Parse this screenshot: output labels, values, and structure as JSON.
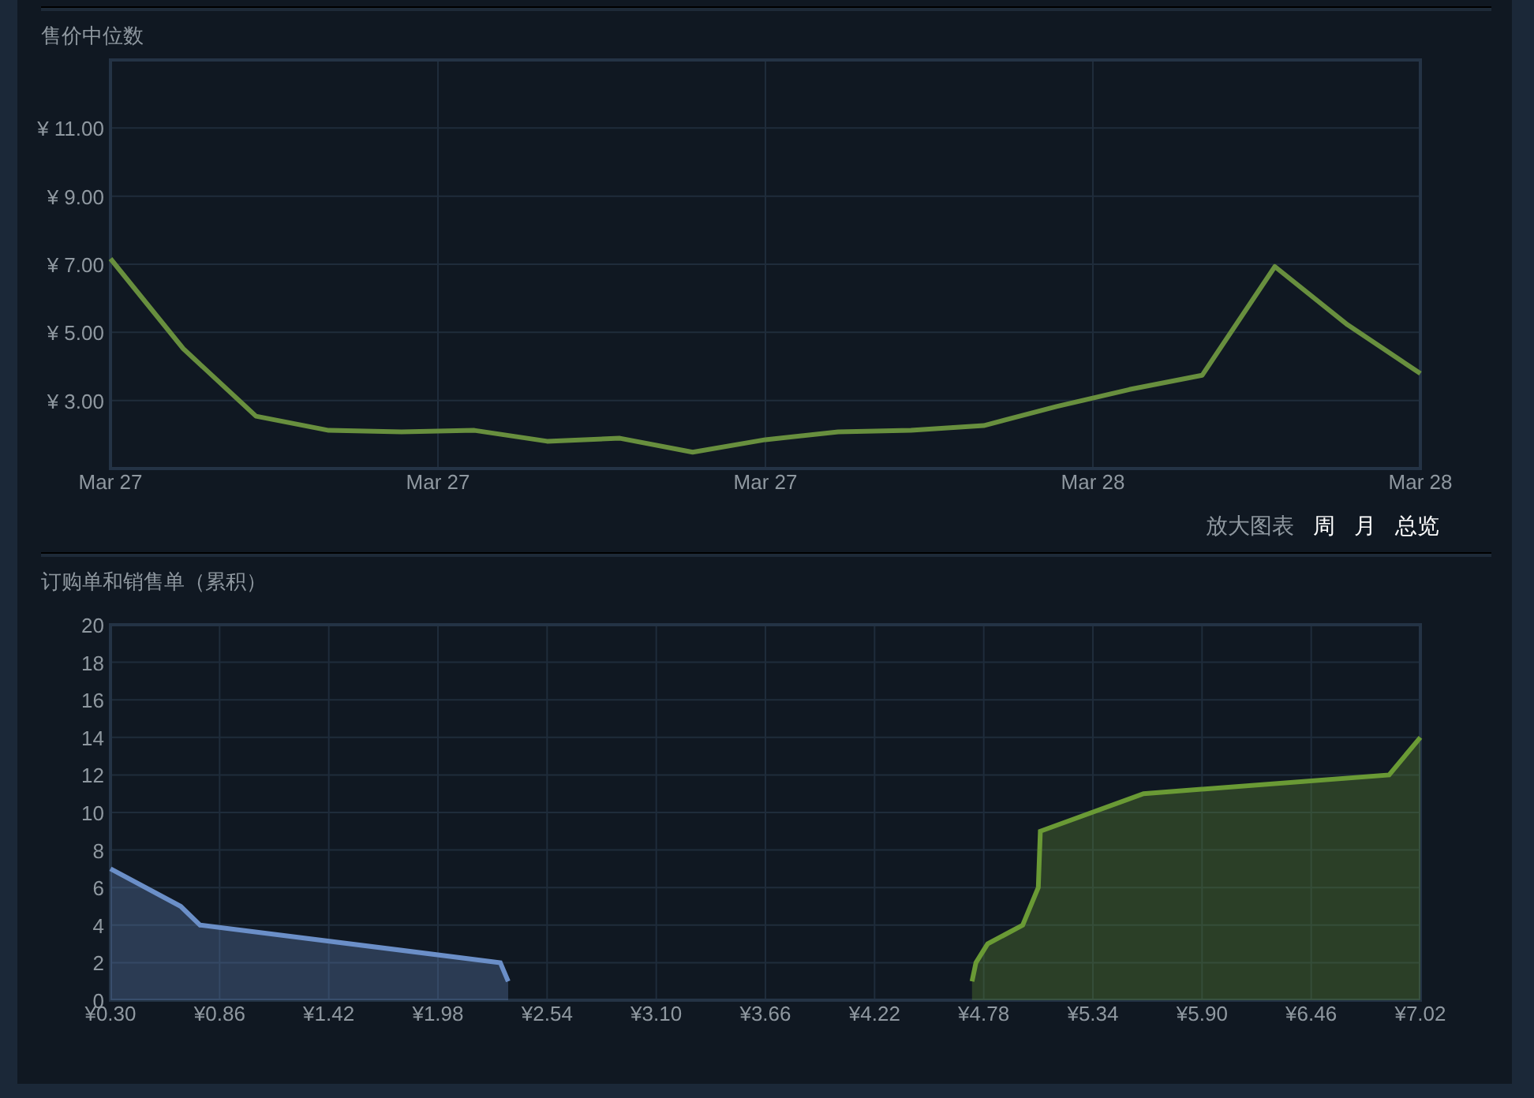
{
  "price_section": {
    "title": "售价中位数",
    "date_labels": [
      "Mar 27",
      "Mar 27",
      "Mar 27",
      "Mar 28",
      "Mar 28"
    ],
    "chart_data": {
      "type": "line",
      "grid": true,
      "ylim": [
        1,
        13
      ],
      "yticks": [
        {
          "value": 3,
          "label": "¥ 3.00"
        },
        {
          "value": 5,
          "label": "¥ 5.00"
        },
        {
          "value": 7,
          "label": "¥ 7.00"
        },
        {
          "value": 9,
          "label": "¥ 9.00"
        },
        {
          "value": 11,
          "label": "¥ 11.00"
        }
      ],
      "series": [
        {
          "color": "#688f3e",
          "values": [
            7.16,
            4.52,
            2.54,
            2.12,
            2.08,
            2.12,
            1.8,
            1.89,
            1.48,
            1.85,
            2.08,
            2.12,
            2.26,
            2.82,
            3.32,
            3.74,
            6.93,
            5.22,
            3.79
          ]
        }
      ]
    }
  },
  "zoom_controls": {
    "label": "放大图表",
    "options": [
      "周",
      "月",
      "总览"
    ]
  },
  "orders_section": {
    "title": "订购单和销售单（累积）",
    "chart_data": {
      "type": "area",
      "grid": true,
      "xlim": [
        0.3,
        7.02
      ],
      "ylim": [
        0,
        20
      ],
      "xticks": [
        {
          "value": 0.3,
          "label": "¥0.30"
        },
        {
          "value": 0.86,
          "label": "¥0.86"
        },
        {
          "value": 1.42,
          "label": "¥1.42"
        },
        {
          "value": 1.98,
          "label": "¥1.98"
        },
        {
          "value": 2.54,
          "label": "¥2.54"
        },
        {
          "value": 3.1,
          "label": "¥3.10"
        },
        {
          "value": 3.66,
          "label": "¥3.66"
        },
        {
          "value": 4.22,
          "label": "¥4.22"
        },
        {
          "value": 4.78,
          "label": "¥4.78"
        },
        {
          "value": 5.34,
          "label": "¥5.34"
        },
        {
          "value": 5.9,
          "label": "¥5.90"
        },
        {
          "value": 6.46,
          "label": "¥6.46"
        },
        {
          "value": 7.02,
          "label": "¥7.02"
        }
      ],
      "yticks": [
        0,
        2,
        4,
        6,
        8,
        10,
        12,
        14,
        16,
        18,
        20
      ],
      "series": [
        {
          "color": "#6b8fc8",
          "x": [
            0.3,
            0.66,
            0.76,
            2.3,
            2.34
          ],
          "values": [
            7,
            5,
            4,
            2,
            1
          ]
        },
        {
          "color": "#6a9a35",
          "x": [
            4.72,
            4.74,
            4.8,
            4.98,
            5.06,
            5.07,
            5.6,
            6.86,
            6.94,
            7.02
          ],
          "values": [
            1,
            2,
            3,
            4,
            6,
            9,
            11,
            12,
            13,
            14
          ]
        }
      ]
    }
  }
}
